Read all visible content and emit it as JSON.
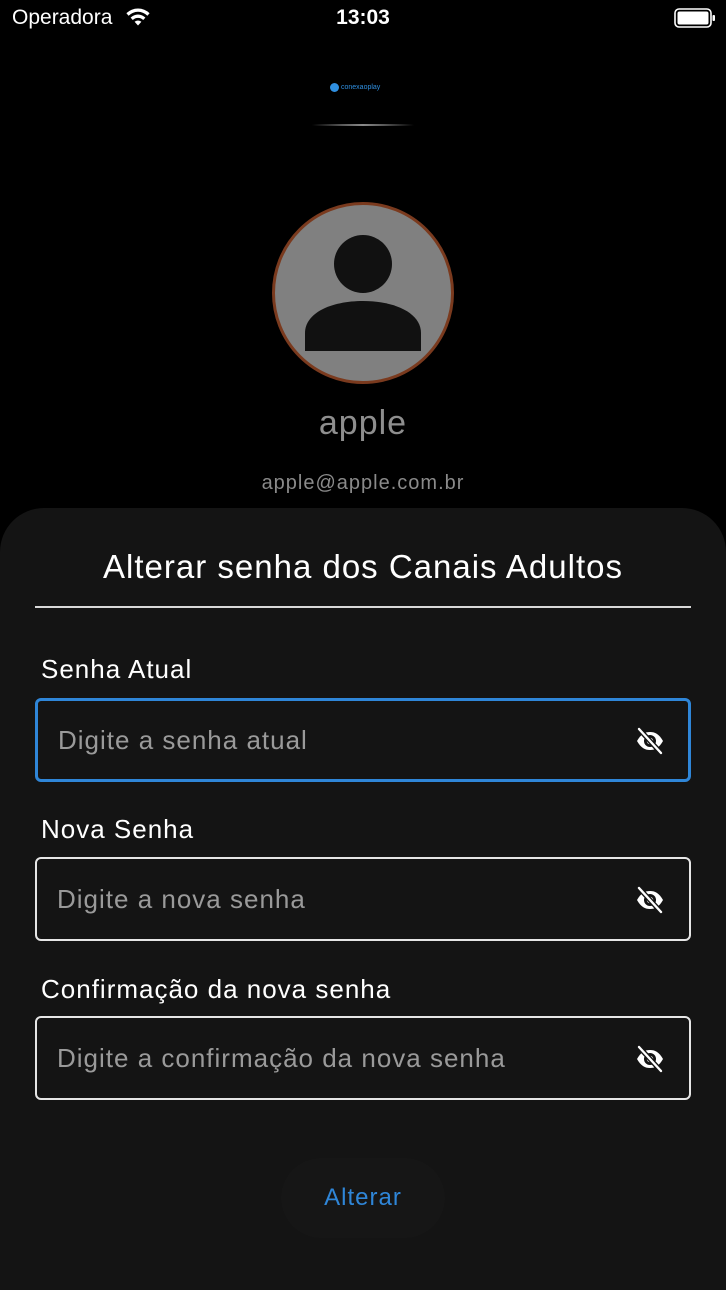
{
  "status_bar": {
    "carrier": "Operadora",
    "time": "13:03"
  },
  "logo": {
    "text": "conexaoplay"
  },
  "profile": {
    "name": "apple",
    "email": "apple@apple.com.br"
  },
  "sheet": {
    "title": "Alterar senha dos Canais Adultos",
    "fields": [
      {
        "label": "Senha Atual",
        "placeholder": "Digite a senha atual",
        "value": "",
        "focused": true
      },
      {
        "label": "Nova Senha",
        "placeholder": "Digite a nova senha",
        "value": "",
        "focused": false
      },
      {
        "label": "Confirmação da nova senha",
        "placeholder": "Digite a confirmação da nova senha",
        "value": "",
        "focused": false
      }
    ],
    "submit_label": "Alterar"
  },
  "icons": {
    "avatar": "person-icon",
    "eye_toggle": "eye-off-icon"
  },
  "colors": {
    "accent": "#2f86d8",
    "avatar_border": "#7a3a1e",
    "sheet_bg": "#141414",
    "background": "#000000"
  }
}
